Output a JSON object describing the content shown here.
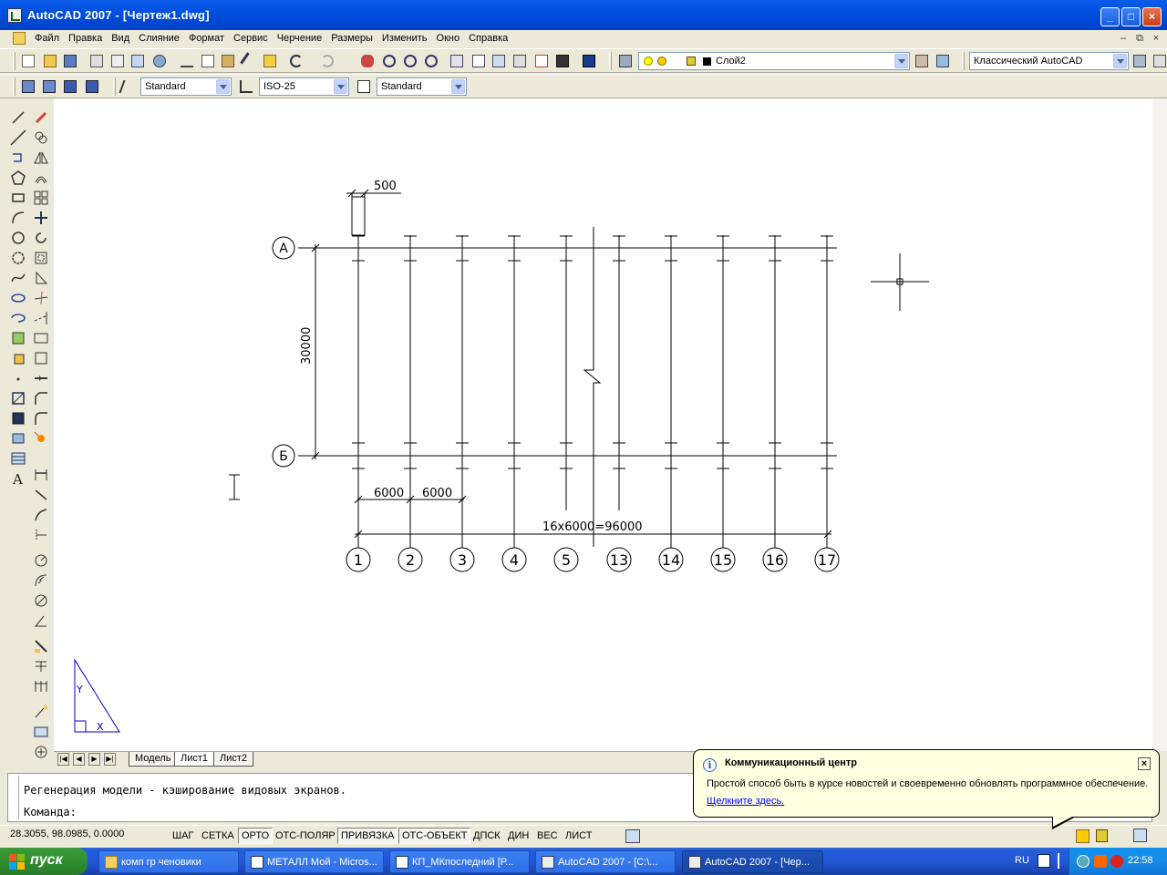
{
  "window": {
    "title": "AutoCAD 2007 - [Чертеж1.dwg]",
    "controls": [
      "_",
      "□",
      "×"
    ]
  },
  "menu": {
    "items": [
      "Файл",
      "Правка",
      "Вид",
      "Слияние",
      "Формат",
      "Сервис",
      "Черчение",
      "Размеры",
      "Изменить",
      "Окно",
      "Справка"
    ],
    "doc_controls": [
      "–",
      "⧉",
      "×"
    ]
  },
  "toolbar": {
    "layer_combo": "Слой2",
    "workspace_combo": "Классический AutoCAD",
    "text_style_combo": "Standard",
    "dim_style_combo": "ISO-25",
    "table_style_combo": "Standard"
  },
  "drawing": {
    "top_dim_label": "500",
    "vertical_dim_label": "30000",
    "axis_row_top": "А",
    "axis_row_bottom": "Б",
    "bay_dim_1": "6000",
    "bay_dim_2": "6000",
    "total_dim_label": "16х6000=96000",
    "axis_columns": [
      "1",
      "2",
      "3",
      "4",
      "5",
      "13",
      "14",
      "15",
      "16",
      "17"
    ],
    "ucs_x": "X",
    "ucs_y": "Y"
  },
  "layout_tabs": {
    "tabs": [
      "Модель",
      "Лист1",
      "Лист2"
    ],
    "active": "Лист1"
  },
  "command": {
    "history_line": "Регенерация модели - кэширование видовых экранов.",
    "prompt": "Команда:"
  },
  "status": {
    "coordinates": "28.3055, 98.0985, 0.0000",
    "buttons": [
      {
        "label": "ШАГ",
        "on": false
      },
      {
        "label": "СЕТКА",
        "on": false
      },
      {
        "label": "ОРТО",
        "on": true
      },
      {
        "label": "ОТС-ПОЛЯР",
        "on": false
      },
      {
        "label": "ПРИВЯЗКА",
        "on": true
      },
      {
        "label": "ОТС-ОБЪЕКТ",
        "on": true
      },
      {
        "label": "ДПСК",
        "on": false
      },
      {
        "label": "ДИН",
        "on": false
      },
      {
        "label": "ВЕС",
        "on": false
      },
      {
        "label": "ЛИСТ",
        "on": false
      }
    ]
  },
  "balloon": {
    "title": "Коммуникационный центр",
    "text": "Простой способ быть в курсе новостей и своевременно обновлять программное обеспечение.",
    "link": "Щелкните здесь.",
    "close": "×"
  },
  "taskbar": {
    "start_label": "пуск",
    "tasks": [
      {
        "label": "комп гр ченовики",
        "active": false
      },
      {
        "label": "МЕТАЛЛ Мой - Micros...",
        "active": false
      },
      {
        "label": "КП_МКпоследний [Р...",
        "active": false
      },
      {
        "label": "AutoCAD 2007 - [C:\\...",
        "active": false
      },
      {
        "label": "AutoCAD 2007 - [Чер...",
        "active": true
      }
    ],
    "language": "RU",
    "clock": "22:58"
  },
  "colors": {
    "titlebar": "#0054e3",
    "drawing_bg": "#ffffff",
    "ucs": "#0000cc",
    "balloon_bg": "#ffffe1",
    "taskbar": "#245edb",
    "start_green": "#2f8f2f"
  }
}
